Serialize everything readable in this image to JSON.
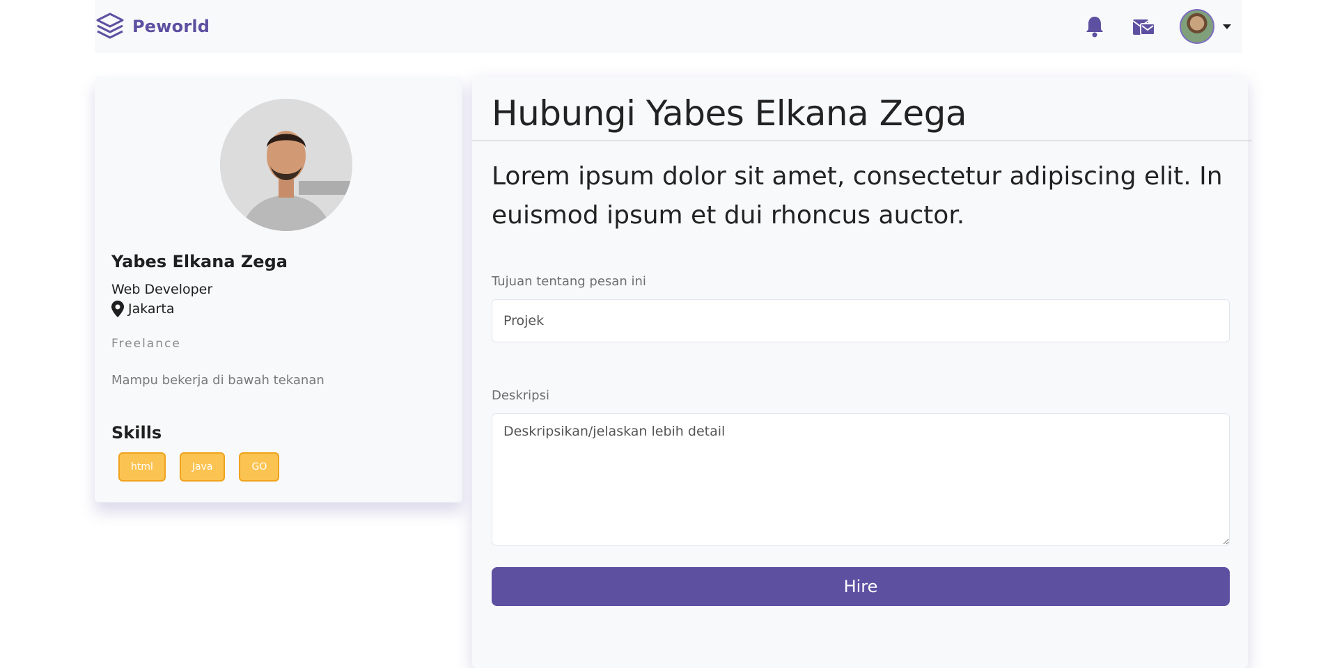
{
  "brand": {
    "name": "Peworld",
    "color": "#5e50a1"
  },
  "navbar": {
    "icons": [
      "bell-icon",
      "mail-icon"
    ],
    "avatar": "user-avatar"
  },
  "profile": {
    "name": "Yabes Elkana Zega",
    "job": "Web Developer",
    "location": "Jakarta",
    "status": "Freelance",
    "description": "Mampu bekerja di bawah tekanan",
    "skills_title": "Skills",
    "skills": [
      "html",
      "Java",
      "GO"
    ]
  },
  "contact": {
    "title": "Hubungi Yabes Elkana Zega",
    "lead": "Lorem ipsum dolor sit amet, consectetur adipiscing elit. In euismod ipsum et dui rhoncus auctor.",
    "purpose_label": "Tujuan tentang pesan ini",
    "purpose_value": "Projek",
    "description_label": "Deskripsi",
    "description_placeholder": "Deskripsikan/jelaskan lebih detail",
    "submit_label": "Hire"
  },
  "colors": {
    "primary": "#5e50a1",
    "skill_badge": "#fbc351",
    "skill_border": "#f0a31c",
    "card_bg": "#f8f9fb"
  }
}
